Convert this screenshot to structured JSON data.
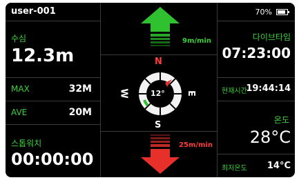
{
  "device": {
    "user_id": "user-001",
    "battery_percent": "70%",
    "battery_level": 0.7
  },
  "depth": {
    "label": "수심",
    "value": "12.3m"
  },
  "max": {
    "label": "MAX",
    "value": "32M"
  },
  "ave": {
    "label": "AVE",
    "value": "20M"
  },
  "stopwatch": {
    "label": "스톱워치",
    "value": "00:00:00"
  },
  "ascent": {
    "rate": "9m/min",
    "color": "#2fc12f"
  },
  "descent": {
    "rate": "25m/min",
    "color": "#e8302b"
  },
  "compass": {
    "heading": "12°",
    "north": "N",
    "south": "S",
    "east": "E",
    "west": "W"
  },
  "dive_time": {
    "label": "다이브타임",
    "value": "07:23:00"
  },
  "current_time": {
    "label": "현재시간",
    "value": "19:44:14"
  },
  "temperature": {
    "label": "온도",
    "value": "28°C"
  },
  "min_temp": {
    "label": "최저온도",
    "value": "14°C"
  }
}
